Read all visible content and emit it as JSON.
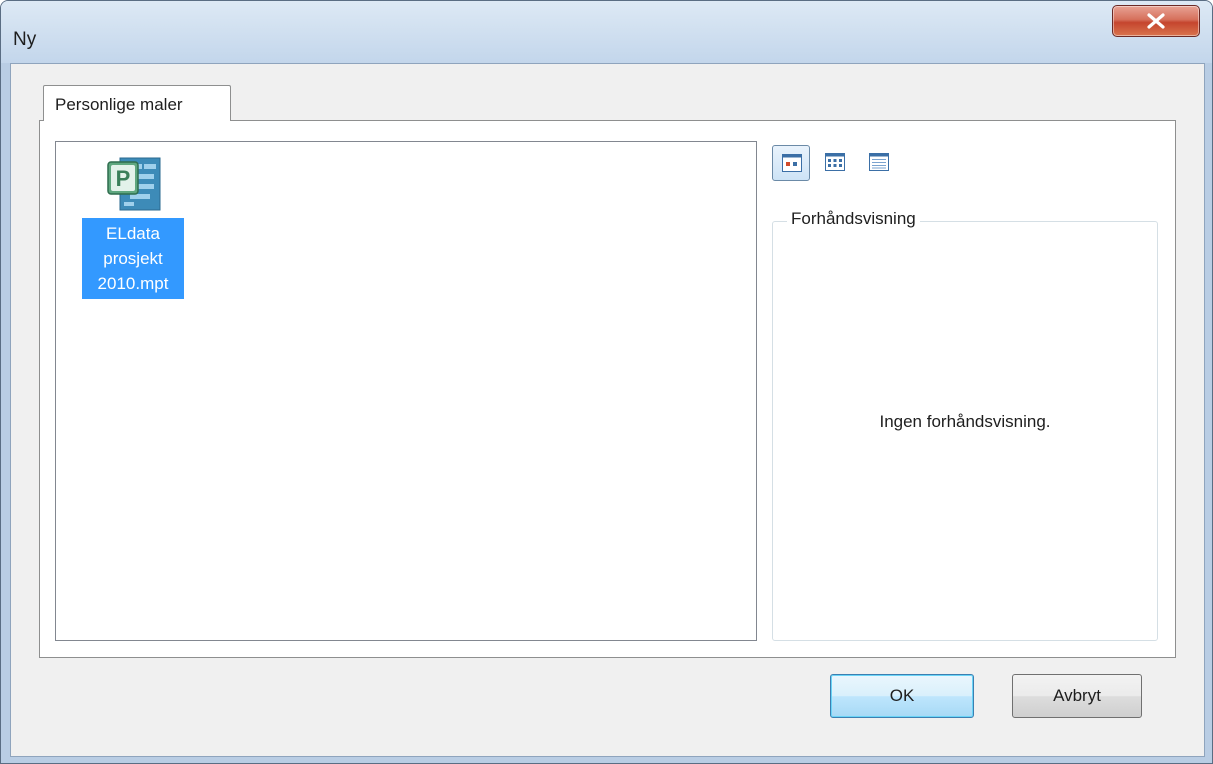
{
  "window": {
    "title": "Ny"
  },
  "tabs": [
    {
      "label": "Personlige maler",
      "selected": true
    }
  ],
  "templates": [
    {
      "name": "ELdata prosjekt 2010.mpt",
      "lines": [
        "ELdata",
        "prosjekt",
        "2010.mpt"
      ],
      "icon": "ms-project-template-icon",
      "selected": true
    }
  ],
  "view_options": [
    {
      "name": "large-icons-view-icon",
      "active": true
    },
    {
      "name": "list-view-icon",
      "active": false
    },
    {
      "name": "details-view-icon",
      "active": false
    }
  ],
  "preview": {
    "legend": "Forhåndsvisning",
    "empty_text": "Ingen forhåndsvisning."
  },
  "buttons": {
    "ok": "OK",
    "cancel": "Avbryt"
  },
  "colors": {
    "selection": "#3399ff",
    "close_button": "#c5452e",
    "default_button_border": "#3c7fb1"
  }
}
